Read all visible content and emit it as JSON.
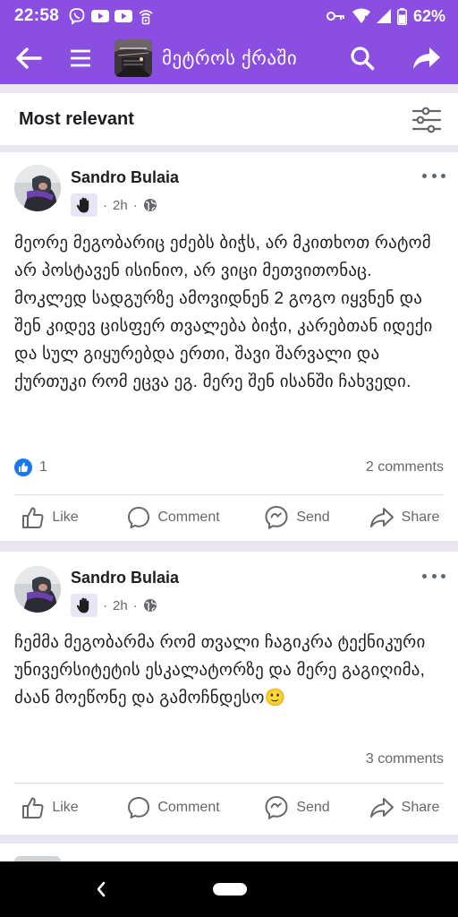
{
  "status_bar": {
    "time": "22:58",
    "battery": "62%",
    "icons": [
      "viber-icon",
      "youtube-icon",
      "youtube-icon",
      "wifi-calling-icon",
      "key-icon",
      "wifi-icon",
      "signal-icon",
      "battery-icon"
    ]
  },
  "app_bar": {
    "title": "მეტროს ქრაში",
    "icons": [
      "back-arrow-icon",
      "menu-icon",
      "search-icon",
      "share-icon"
    ]
  },
  "sort": {
    "label": "Most relevant"
  },
  "posts": [
    {
      "author": "Sandro Bulaia",
      "time": "2h",
      "separator": "·",
      "privacy_icon": "globe-icon",
      "badge_icon": "hand-icon",
      "text": "მეორე მეგობარიც ეძებს ბიჭს, არ მკითხოთ რატომ არ პოსტავენ ისინიო, არ ვიცი მეთვითონაც. მოკლედ სადგურზე ამოვიდნენ 2 გოგო იყვნენ და შენ კიდევ ცისფერ თვალება ბიჭი, კარებთან იდექი და სულ გიყურებდა ერთი, შავი შარვალი და ქურთუკი რომ ეცვა ეგ. მერე შენ ისანში ჩახვედი.",
      "reactions": "1",
      "comments": "2 comments"
    },
    {
      "author": "Sandro Bulaia",
      "time": "2h",
      "separator": "·",
      "privacy_icon": "globe-icon",
      "badge_icon": "hand-icon",
      "text": "ჩემმა მეგობარმა რომ თვალი ჩაგიკრა ტექნიკური უნივერსიტეტის ესკალატორზე და მერე გაგიღიმა, ძაან მოეწონე და გამოჩნდესო🙂",
      "reactions": "",
      "comments": "3 comments"
    }
  ],
  "actions": {
    "like": "Like",
    "comment": "Comment",
    "send": "Send",
    "share": "Share"
  },
  "colors": {
    "accent": "#8a4fe0",
    "like_blue": "#1877f2",
    "text": "#1c1e21",
    "secondary": "#65676b"
  }
}
